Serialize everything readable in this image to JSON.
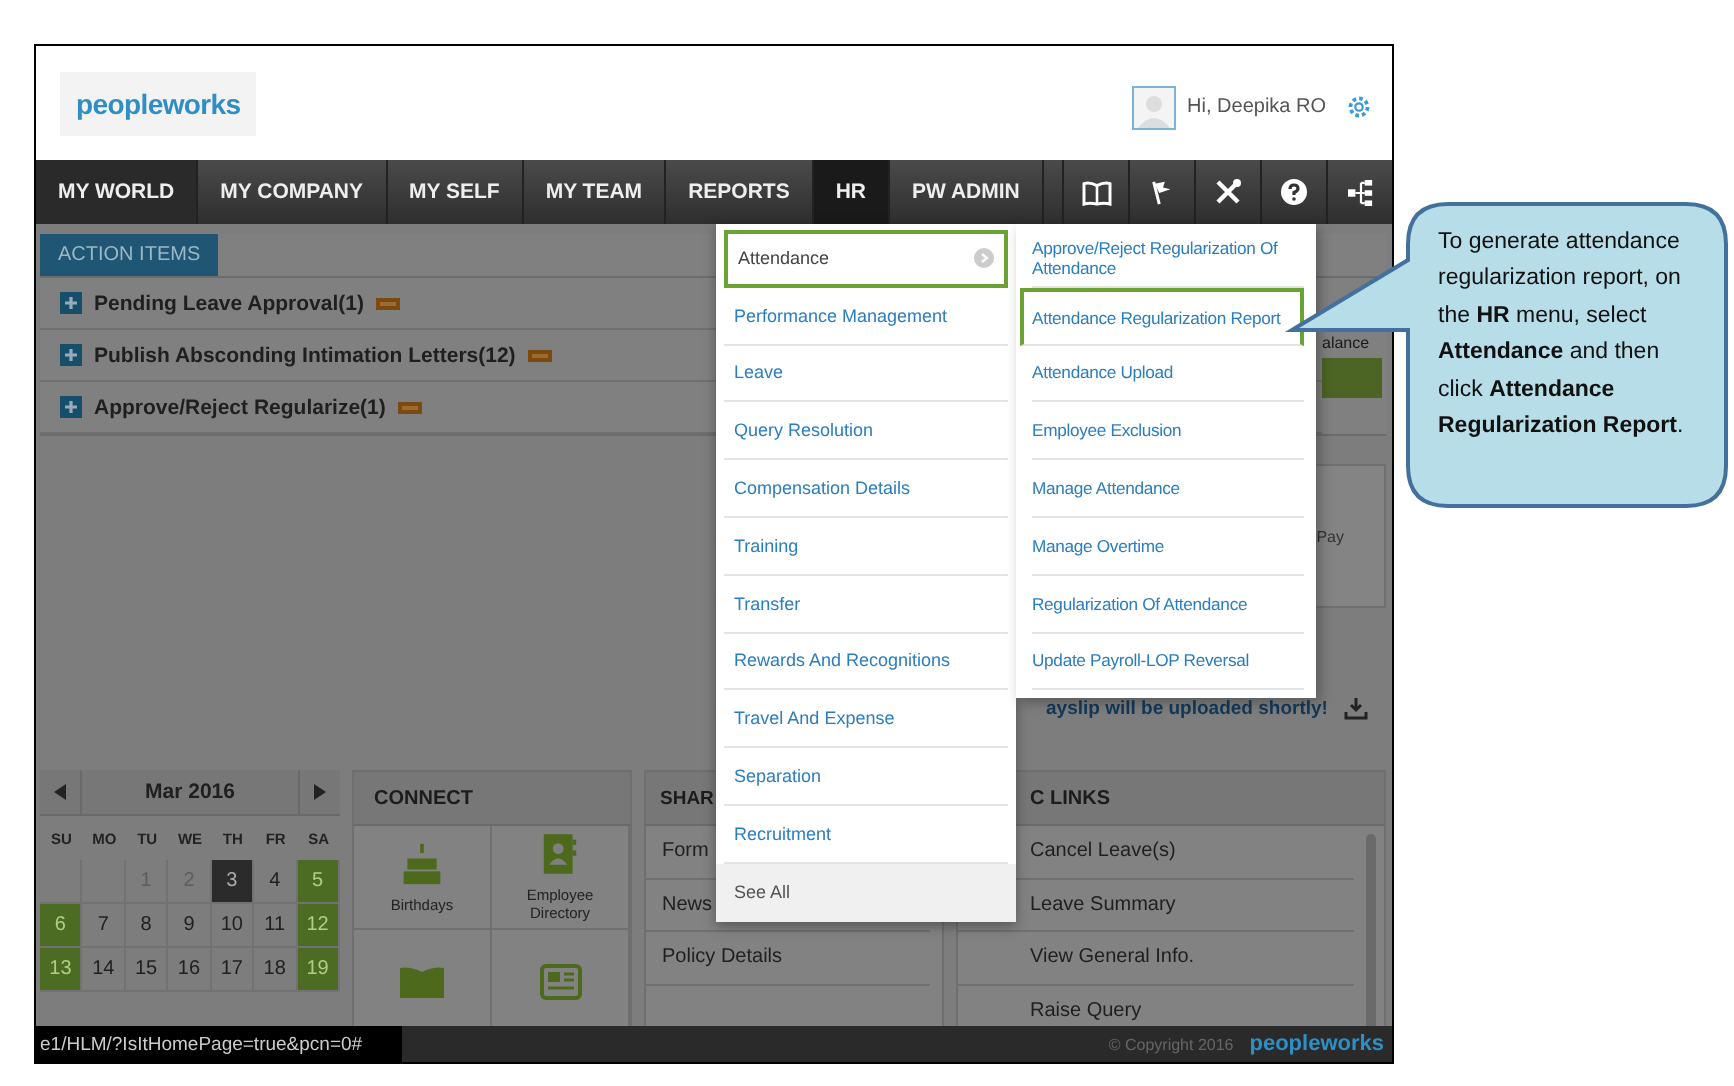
{
  "header": {
    "logo": "peopleworks",
    "greeting": "Hi, Deepika RO"
  },
  "nav": {
    "items": [
      {
        "label": "MY WORLD",
        "current": true,
        "selected": false
      },
      {
        "label": "MY COMPANY",
        "current": false,
        "selected": false
      },
      {
        "label": "MY SELF",
        "current": false,
        "selected": false
      },
      {
        "label": "MY TEAM",
        "current": false,
        "selected": false
      },
      {
        "label": "REPORTS",
        "current": false,
        "selected": false
      },
      {
        "label": "HR",
        "current": false,
        "selected": true
      },
      {
        "label": "PW ADMIN",
        "current": false,
        "selected": false
      }
    ],
    "icons": [
      {
        "kind": "book"
      },
      {
        "kind": "flag"
      },
      {
        "kind": "tools"
      },
      {
        "kind": "help"
      },
      {
        "kind": "sitemap"
      }
    ]
  },
  "action_items": {
    "tab": "ACTION ITEMS",
    "rows": [
      {
        "label": "Pending Leave Approval(1)",
        "new": true
      },
      {
        "label": "Publish Absconding Intimation Letters(12)",
        "new": true
      },
      {
        "label": "Approve/Reject Regularize(1)",
        "new": true
      }
    ],
    "side_label": "alance"
  },
  "pay_panel": {
    "label": "Pay"
  },
  "payslip_notice": "ayslip will be uploaded shortly!",
  "calendar": {
    "month": "Mar 2016",
    "weekdays": [
      "SU",
      "MO",
      "TU",
      "WE",
      "TH",
      "FR",
      "SA"
    ],
    "weeks": [
      [
        {
          "kind": "blank"
        },
        {
          "kind": "blank"
        },
        {
          "kind": "day",
          "label": "1",
          "muted": true,
          "weekend": false,
          "selected": false
        },
        {
          "kind": "day",
          "label": "2",
          "muted": true,
          "weekend": false,
          "selected": false
        },
        {
          "kind": "day",
          "label": "3",
          "muted": false,
          "weekend": false,
          "selected": true
        },
        {
          "kind": "day",
          "label": "4",
          "muted": false,
          "weekend": false,
          "selected": false
        },
        {
          "kind": "day",
          "label": "5",
          "muted": false,
          "weekend": true,
          "selected": false
        }
      ],
      [
        {
          "kind": "day",
          "label": "6",
          "muted": false,
          "weekend": true,
          "selected": false
        },
        {
          "kind": "day",
          "label": "7",
          "muted": false,
          "weekend": false,
          "selected": false
        },
        {
          "kind": "day",
          "label": "8",
          "muted": false,
          "weekend": false,
          "selected": false
        },
        {
          "kind": "day",
          "label": "9",
          "muted": false,
          "weekend": false,
          "selected": false
        },
        {
          "kind": "day",
          "label": "10",
          "muted": false,
          "weekend": false,
          "selected": false
        },
        {
          "kind": "day",
          "label": "11",
          "muted": false,
          "weekend": false,
          "selected": false
        },
        {
          "kind": "day",
          "label": "12",
          "muted": false,
          "weekend": true,
          "selected": false
        }
      ],
      [
        {
          "kind": "day",
          "label": "13",
          "muted": false,
          "weekend": true,
          "selected": false
        },
        {
          "kind": "day",
          "label": "14",
          "muted": false,
          "weekend": false,
          "selected": false
        },
        {
          "kind": "day",
          "label": "15",
          "muted": false,
          "weekend": false,
          "selected": false
        },
        {
          "kind": "day",
          "label": "16",
          "muted": false,
          "weekend": false,
          "selected": false
        },
        {
          "kind": "day",
          "label": "17",
          "muted": false,
          "weekend": false,
          "selected": false
        },
        {
          "kind": "day",
          "label": "18",
          "muted": false,
          "weekend": false,
          "selected": false
        },
        {
          "kind": "day",
          "label": "19",
          "muted": false,
          "weekend": true,
          "selected": false
        }
      ]
    ]
  },
  "connect": {
    "title": "CONNECT",
    "tiles": [
      {
        "kind": "cake",
        "label": "Birthdays"
      },
      {
        "kind": "directory",
        "label": "Employee Directory"
      },
      {
        "kind": "book"
      },
      {
        "kind": "newspaper"
      }
    ]
  },
  "shared": {
    "title": "SHAR",
    "items": [
      "Form",
      "News",
      "Policy Details"
    ]
  },
  "quick_links": {
    "title": "C LINKS",
    "items": [
      "Cancel Leave(s)",
      "Leave Summary",
      "View General Info.",
      "Raise Query"
    ]
  },
  "hr_menu": {
    "items": [
      {
        "kind": "link",
        "label": "Attendance",
        "selected": true,
        "has_submenu": true
      },
      {
        "kind": "link",
        "label": "Performance Management",
        "selected": false,
        "has_submenu": false
      },
      {
        "kind": "link",
        "label": "Leave",
        "selected": false,
        "has_submenu": false
      },
      {
        "kind": "link",
        "label": "Query Resolution",
        "selected": false,
        "has_submenu": false
      },
      {
        "kind": "link",
        "label": "Compensation Details",
        "selected": false,
        "has_submenu": false
      },
      {
        "kind": "link",
        "label": "Training",
        "selected": false,
        "has_submenu": false
      },
      {
        "kind": "link",
        "label": "Transfer",
        "selected": false,
        "has_submenu": false
      },
      {
        "kind": "link",
        "label": "Rewards And Recognitions",
        "selected": false,
        "has_submenu": false
      },
      {
        "kind": "link",
        "label": "Travel And Expense",
        "selected": false,
        "has_submenu": false
      },
      {
        "kind": "link",
        "label": "Separation",
        "selected": false,
        "has_submenu": false
      },
      {
        "kind": "link",
        "label": "Recruitment",
        "selected": false,
        "has_submenu": false
      },
      {
        "kind": "footer",
        "label": "See All",
        "selected": false,
        "has_submenu": false
      }
    ],
    "submenu": [
      {
        "label": "Approve/Reject Regularization Of Attendance",
        "selected": false
      },
      {
        "label": "Attendance Regularization Report",
        "selected": true
      },
      {
        "label": "Attendance Upload",
        "selected": false
      },
      {
        "label": "Employee Exclusion",
        "selected": false
      },
      {
        "label": "Manage Attendance",
        "selected": false
      },
      {
        "label": "Manage Overtime",
        "selected": false
      },
      {
        "label": "Regularization Of Attendance",
        "selected": false
      },
      {
        "label": "Update Payroll-LOP Reversal",
        "selected": false
      }
    ]
  },
  "status_bar": {
    "url": "e1/HLM/?IsItHomePage=true&pcn=0#",
    "copyright": "© Copyright 2016",
    "logo": "peopleworks"
  },
  "callout": {
    "text": "To generate attendance regularization report, on the **HR** menu, select **Attendance** and then click **Attendance Regularization Report**."
  }
}
